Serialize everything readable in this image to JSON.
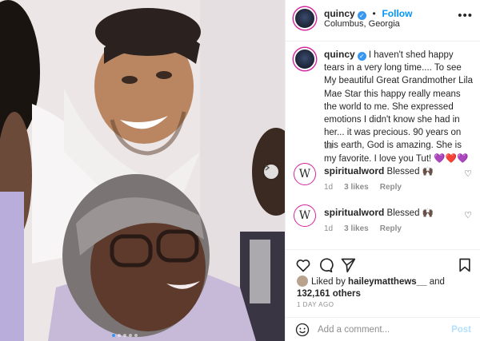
{
  "post": {
    "username": "quincy",
    "follow_label": "Follow",
    "location": "Columbus, Georgia",
    "more_label": "•••",
    "verified_glyph": "✓"
  },
  "caption": {
    "username": "quincy",
    "text": "I haven't shed happy tears in a very long time.... To see My beautiful Great Grandmother Lila Mae Star this happy really means the world to me. She expressed emotions I didn't know she had in her... it was precious. 90 years on this earth, God is amazing. She is my favorite. I love you Tut! 💜❤️💜",
    "time": "1d"
  },
  "comments": [
    {
      "username": "spiritualword",
      "text": "Blessed 🙌🏿",
      "time": "1d",
      "likes": "3 likes",
      "reply_label": "Reply"
    },
    {
      "username": "spiritualword",
      "text": "Blessed 🙌🏿",
      "time": "1d",
      "likes": "3 likes",
      "reply_label": "Reply"
    }
  ],
  "likes": {
    "prefix": "Liked by",
    "user": "haileymatthews__",
    "and": "and",
    "count": "132,161 others"
  },
  "timestamp": "1 DAY AGO",
  "add_comment": {
    "placeholder": "Add a comment...",
    "post_label": "Post"
  },
  "icons": [
    "heart-icon",
    "comment-icon",
    "share-icon",
    "bookmark-icon",
    "emoji-icon",
    "carousel-next-icon"
  ],
  "colors": {
    "accent": "#0095f6",
    "verified": "#3897f0",
    "muted": "#8e8e8e",
    "ring": "#d6249f"
  }
}
